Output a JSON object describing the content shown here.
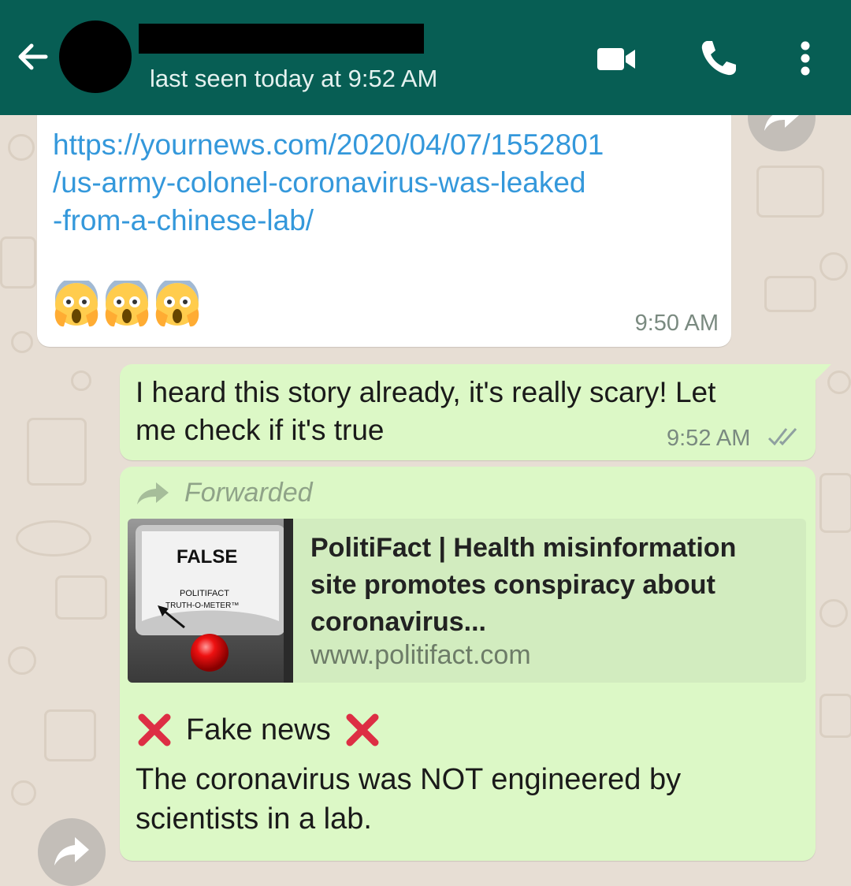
{
  "header": {
    "last_seen": "last seen today at 9:52 AM",
    "bg_color": "#075e54",
    "icons": [
      "back-arrow-icon",
      "video-call-icon",
      "phone-icon",
      "more-options-icon"
    ]
  },
  "messages": {
    "incoming": {
      "link_lines": [
        "https://yournews.com/2020/04/07/1552801",
        "/us-army-colonel-coronavirus-was-leaked",
        "-from-a-chinese-lab/"
      ],
      "emojis": [
        "scream-emoji",
        "scream-emoji",
        "scream-emoji"
      ],
      "time": "9:50 AM"
    },
    "outgoing_reply": {
      "line1": "I heard this story already, it's really scary! Let",
      "line2": "me check if it's true",
      "time": "9:52 AM",
      "status": "read"
    },
    "outgoing_forward": {
      "forwarded_label": "Forwarded",
      "preview": {
        "thumb_label": "FALSE",
        "thumb_line1": "POLITIFACT",
        "thumb_line2": "TRUTH-O-METER™",
        "title": "PolitiFact | Health misinformation site promotes conspiracy about coronavirus...",
        "url": "www.politifact.com"
      },
      "fake_news": "Fake news",
      "body": "The coronavirus was NOT engineered by scientists in a lab."
    }
  },
  "colors": {
    "outgoing_bubble": "#dcf8c6",
    "incoming_bubble": "#ffffff",
    "link": "#3498db",
    "read_ticks": "#8fa0a0"
  }
}
